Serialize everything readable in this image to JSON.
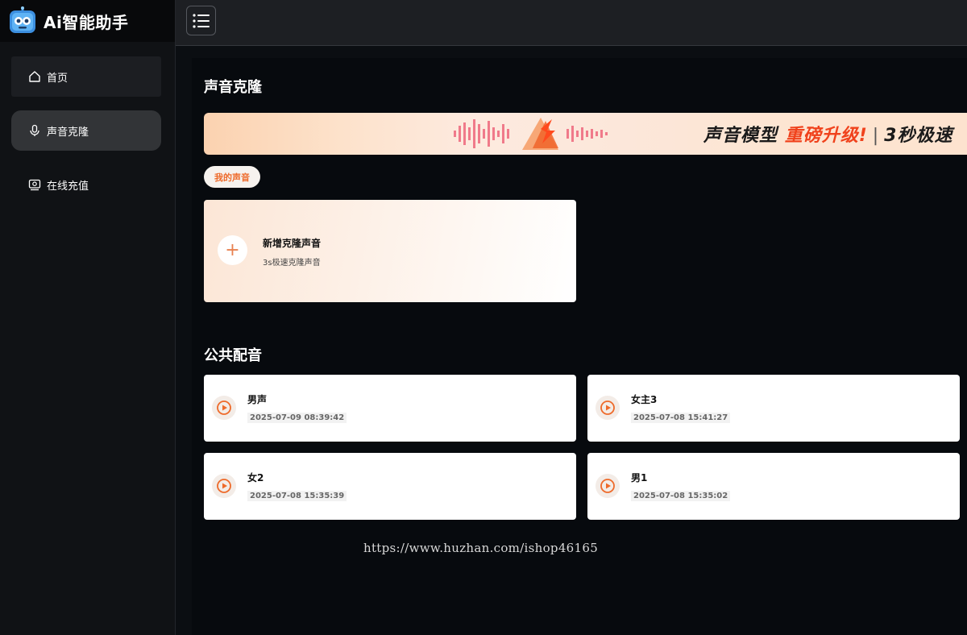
{
  "app": {
    "title": "Ai智能助手",
    "logo_icon": "robot-logo-icon"
  },
  "sidebar": {
    "items": [
      {
        "label": "首页",
        "icon": "home-icon"
      },
      {
        "label": "声音克隆",
        "icon": "microphone-icon",
        "active": true
      },
      {
        "label": "在线充值",
        "icon": "recharge-icon"
      }
    ]
  },
  "topbar": {
    "menu_icon": "list-menu-icon"
  },
  "page": {
    "title": "声音克隆",
    "banner": {
      "text_1": "声音模型",
      "text_2": "重磅升级!",
      "text_3": "3秒极速"
    },
    "my_voice_tab": "我的声音",
    "add_card": {
      "title": "新增克隆声音",
      "subtitle": "3s极速克隆声音",
      "icon": "plus-icon"
    },
    "public_title": "公共配音",
    "voices": [
      {
        "name": "男声",
        "date": "2025-07-09 08:39:42"
      },
      {
        "name": "女主3",
        "date": "2025-07-08 15:41:27"
      },
      {
        "name": "女2",
        "date": "2025-07-08 15:35:39"
      },
      {
        "name": "男1",
        "date": "2025-07-08 15:35:02"
      }
    ]
  },
  "watermark": "https://www.huzhan.com/ishop46165",
  "colors": {
    "accent": "#ee6a2a",
    "sidebar_bg": "#101215",
    "main_bg": "#070a0e",
    "card_bg": "#ffffff"
  }
}
